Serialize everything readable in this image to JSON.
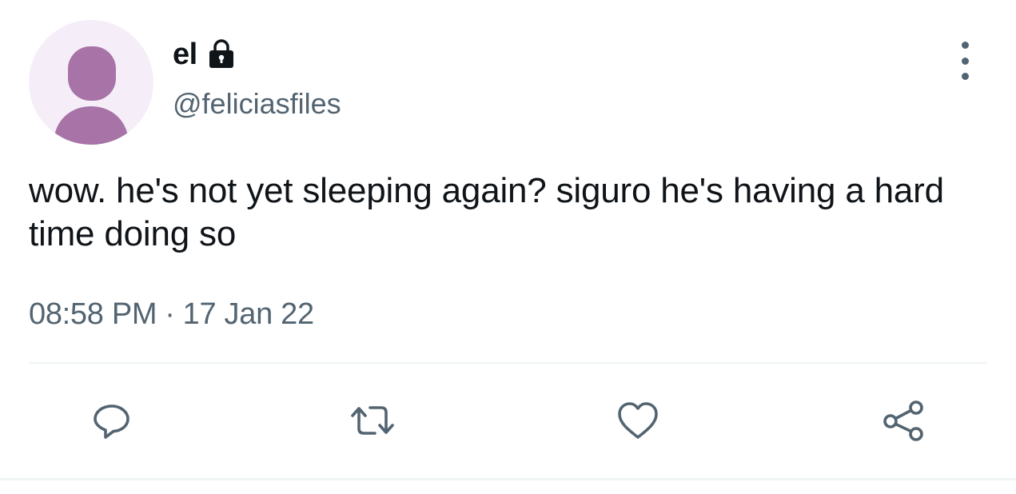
{
  "author": {
    "display_name": "el",
    "handle": "@feliciasfiles",
    "avatar_icon": "default-avatar-icon",
    "protected_icon": "lock-icon"
  },
  "tweet": {
    "text": "wow. he's not yet sleeping again? siguro he's having a hard time doing so",
    "time": "08:58 PM",
    "separator": "·",
    "date": "17 Jan 22"
  },
  "actions": {
    "reply_icon": "reply-icon",
    "retweet_icon": "retweet-icon",
    "like_icon": "heart-icon",
    "share_icon": "share-icon",
    "more_icon": "more-vertical-icon"
  },
  "colors": {
    "text": "#0f1419",
    "secondary": "#536471",
    "avatar_bg": "#f5eef9",
    "avatar_figure": "#a874a8",
    "divider": "#eff3f4"
  }
}
